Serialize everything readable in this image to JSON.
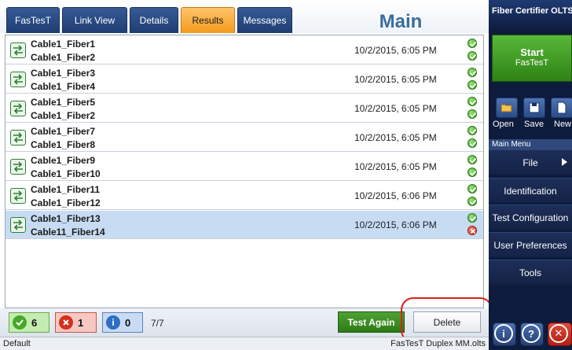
{
  "tabs": [
    {
      "label": "FasTesT",
      "active": false
    },
    {
      "label": "Link View",
      "active": false
    },
    {
      "label": "Details",
      "active": false
    },
    {
      "label": "Results",
      "active": true
    },
    {
      "label": "Messages",
      "active": false
    }
  ],
  "page_title": "Main",
  "results": [
    {
      "fiber1": "Cable1_Fiber1",
      "fiber2": "Cable1_Fiber2",
      "date": "10/2/2015, 6:05 PM",
      "status1": "pass",
      "status2": "pass",
      "selected": false
    },
    {
      "fiber1": "Cable1_Fiber3",
      "fiber2": "Cable1_Fiber4",
      "date": "10/2/2015, 6:05 PM",
      "status1": "pass",
      "status2": "pass",
      "selected": false
    },
    {
      "fiber1": "Cable1_Fiber5",
      "fiber2": "Cable1_Fiber2",
      "date": "10/2/2015, 6:05 PM",
      "status1": "pass",
      "status2": "pass",
      "selected": false
    },
    {
      "fiber1": "Cable1_Fiber7",
      "fiber2": "Cable1_Fiber8",
      "date": "10/2/2015, 6:05 PM",
      "status1": "pass",
      "status2": "pass",
      "selected": false
    },
    {
      "fiber1": "Cable1_Fiber9",
      "fiber2": "Cable1_Fiber10",
      "date": "10/2/2015, 6:05 PM",
      "status1": "pass",
      "status2": "pass",
      "selected": false
    },
    {
      "fiber1": "Cable1_Fiber11",
      "fiber2": "Cable1_Fiber12",
      "date": "10/2/2015, 6:06 PM",
      "status1": "pass",
      "status2": "pass",
      "selected": false
    },
    {
      "fiber1": "Cable1_Fiber13",
      "fiber2": "Cable11_Fiber14",
      "date": "10/2/2015, 6:06 PM",
      "status1": "pass",
      "status2": "fail",
      "selected": true
    }
  ],
  "summary": {
    "pass_count": "6",
    "fail_count": "1",
    "info_count": "0",
    "ratio": "7/7"
  },
  "buttons": {
    "test_again": "Test Again",
    "delete": "Delete"
  },
  "status": {
    "left": "Default",
    "right": "FasTesT Duplex MM.olts"
  },
  "right_panel": {
    "title": "Fiber Certifier OLTS",
    "start_line1": "Start",
    "start_line2": "FasTesT",
    "file_buttons": [
      "Open",
      "Save",
      "New"
    ],
    "menu_header": "Main Menu",
    "menu_items": [
      "File",
      "Identification",
      "Test Configuration",
      "User Preferences",
      "Tools"
    ]
  },
  "colors": {
    "accent_tab": "#f39a1c",
    "tab_bg": "#1f3d72",
    "pass": "#45a82a",
    "fail": "#d4301c",
    "info": "#2f6ec2",
    "panel_bg": "#0d1b3c",
    "highlight": "#d9201a"
  },
  "icons": {
    "row": "swap-arrows-icon",
    "pass": "check-circle-icon",
    "fail": "x-circle-icon",
    "info": "info-circle-icon"
  }
}
